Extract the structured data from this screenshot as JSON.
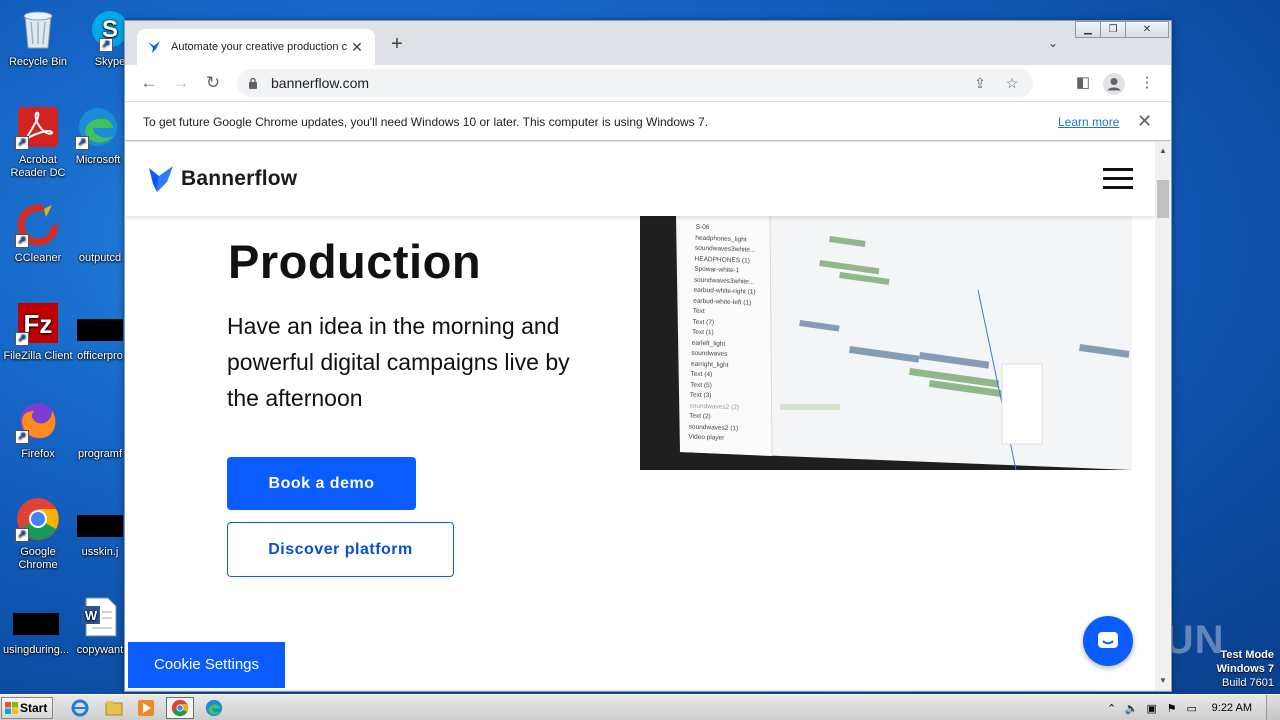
{
  "desktop": {
    "icons": [
      {
        "name": "recycle-bin",
        "label": "Recycle Bin"
      },
      {
        "name": "skype",
        "label": "Skype"
      },
      {
        "name": "acrobat",
        "label": "Acrobat Reader DC"
      },
      {
        "name": "microsoft-edge",
        "label": "Microsoft"
      },
      {
        "name": "ccleaner",
        "label": "CCleaner"
      },
      {
        "name": "outputcd",
        "label": "outputcd"
      },
      {
        "name": "filezilla",
        "label": "FileZilla Client"
      },
      {
        "name": "officerpro",
        "label": "officerpro"
      },
      {
        "name": "firefox",
        "label": "Firefox"
      },
      {
        "name": "programf",
        "label": "programf"
      },
      {
        "name": "google-chrome",
        "label": "Google Chrome"
      },
      {
        "name": "usskin",
        "label": "usskin.j"
      },
      {
        "name": "usingduring",
        "label": "usingduring..."
      },
      {
        "name": "copywant",
        "label": "copywant"
      }
    ]
  },
  "browser": {
    "tab_title": "Automate your creative production c",
    "url": "bannerflow.com",
    "infobar": {
      "message": "To get future Google Chrome updates, you'll need Windows 10 or later. This computer is using Windows 7.",
      "link": "Learn more"
    }
  },
  "page": {
    "brand": "Bannerflow",
    "hero_title": "Production",
    "hero_subtitle": "Have an idea in the morning and powerful digital campaigns live by the afternoon",
    "cta_primary": "Book a demo",
    "cta_secondary": "Discover platform",
    "cookie_settings": "Cookie Settings",
    "screenshot_layers": [
      "S-06",
      "headphones_light",
      "soundwaves3white...",
      "HEADPHONES (1)",
      "Spowar-white-1",
      "soundwaves3white...",
      "earbud-white-right (1)",
      "earbud-white-left (1)",
      "Text",
      "Text (7)",
      "Text (1)",
      "earleft_light",
      "soundwaves",
      "earright_light",
      "Text (4)",
      "Text (5)",
      "Text (3)",
      "soundwaves2 (2)",
      "Text (2)",
      "soundwaves2 (1)",
      "Video player"
    ]
  },
  "colors": {
    "brand_blue": "#0a5cff",
    "desktop_blue": "#1567c8"
  },
  "watermark": "ANY RUN",
  "os": {
    "test_mode_line1": "Test Mode",
    "test_mode_line2": "Windows 7",
    "build": "Build 7601",
    "start_label": "Start",
    "clock": "9:22 AM"
  }
}
